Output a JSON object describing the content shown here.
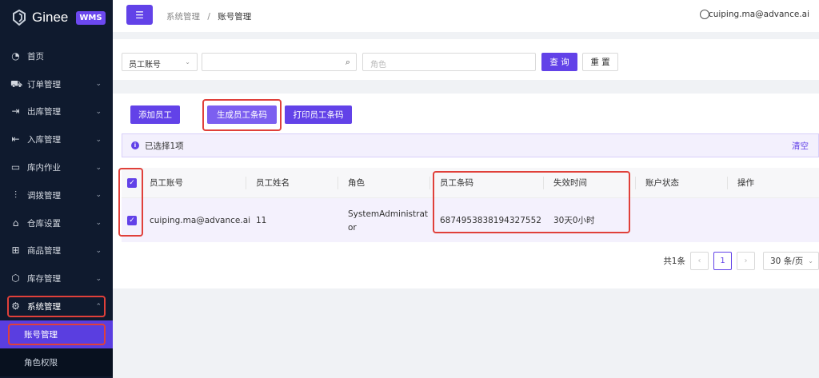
{
  "app": {
    "name": "Ginee",
    "badge": "WMS"
  },
  "sidebar": {
    "items": [
      {
        "label": "首页",
        "icon": "dashboard-icon",
        "glyph": "◔",
        "arrow": ""
      },
      {
        "label": "订单管理",
        "icon": "cart-icon",
        "glyph": "⛟",
        "arrow": "⌄"
      },
      {
        "label": "出库管理",
        "icon": "outbound-icon",
        "glyph": "⇥",
        "arrow": "⌄"
      },
      {
        "label": "入库管理",
        "icon": "inbound-icon",
        "glyph": "⇤",
        "arrow": "⌄"
      },
      {
        "label": "库内作业",
        "icon": "warehouse-task-icon",
        "glyph": "▭",
        "arrow": "⌄"
      },
      {
        "label": "调拨管理",
        "icon": "transfer-icon",
        "glyph": "⫶",
        "arrow": "⌄"
      },
      {
        "label": "仓库设置",
        "icon": "warehouse-settings-icon",
        "glyph": "⌂",
        "arrow": "⌄"
      },
      {
        "label": "商品管理",
        "icon": "product-icon",
        "glyph": "⊞",
        "arrow": "⌄"
      },
      {
        "label": "库存管理",
        "icon": "inventory-icon",
        "glyph": "⬡",
        "arrow": "⌄"
      },
      {
        "label": "系统管理",
        "icon": "gear-icon",
        "glyph": "⚙",
        "arrow": "⌃"
      }
    ],
    "sub_items": [
      {
        "label": "账号管理"
      },
      {
        "label": "角色权限"
      }
    ]
  },
  "header": {
    "menu_toggle": "☰",
    "breadcrumb_parent": "系统管理",
    "breadcrumb_sep": "/",
    "breadcrumb_current": "账号管理",
    "user": "cuiping.ma@advance.ai"
  },
  "search": {
    "field_select": "员工账号",
    "keyword_value": "",
    "role_placeholder": "角色",
    "query_label": "查 询",
    "reset_label": "重 置"
  },
  "actions": {
    "add": "添加员工",
    "generate": "生成员工条码",
    "print": "打印员工条码"
  },
  "selection": {
    "text": "已选择1项",
    "clear": "清空"
  },
  "table": {
    "headers": [
      "员工账号",
      "员工姓名",
      "角色",
      "员工条码",
      "失效时间",
      "账户状态",
      "操作"
    ],
    "rows": [
      {
        "account": "cuiping.ma@advance.ai",
        "name": "11",
        "role_line1": "SystemAdministrat",
        "role_line2": "or",
        "barcode": "6874953838194327552",
        "expire": "30天0小时",
        "status": "",
        "ops": ""
      }
    ]
  },
  "pagination": {
    "total": "共1条",
    "page": "1",
    "page_size": "30 条/页"
  },
  "colors": {
    "accent": "#6242e8",
    "highlight": "#e0403a",
    "sidebar_bg": "#0f1a2e"
  }
}
